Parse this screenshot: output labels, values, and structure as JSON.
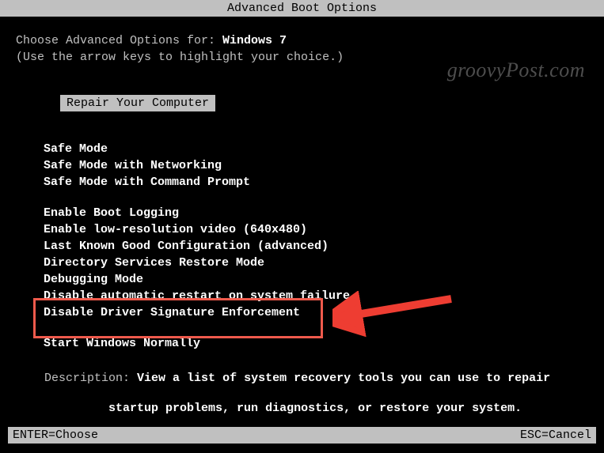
{
  "title": "Advanced Boot Options",
  "prompt_prefix": "Choose Advanced Options for: ",
  "os_name": "Windows 7",
  "hint": "(Use the arrow keys to highlight your choice.)",
  "selected_option": "Repair Your Computer",
  "group1": [
    "Safe Mode",
    "Safe Mode with Networking",
    "Safe Mode with Command Prompt"
  ],
  "group2": [
    "Enable Boot Logging",
    "Enable low-resolution video (640x480)",
    "Last Known Good Configuration (advanced)",
    "Directory Services Restore Mode",
    "Debugging Mode",
    "Disable automatic restart on system failure",
    "Disable Driver Signature Enforcement"
  ],
  "group3": [
    "Start Windows Normally"
  ],
  "description_label": "Description: ",
  "description_line1": "View a list of system recovery tools you can use to repair",
  "description_line2": "startup problems, run diagnostics, or restore your system.",
  "footer_left": "ENTER=Choose",
  "footer_right": "ESC=Cancel",
  "watermark": "groovyPost.com",
  "annotation": {
    "highlight_target": "Disable Driver Signature Enforcement",
    "arrow_color": "#ee3d32"
  }
}
